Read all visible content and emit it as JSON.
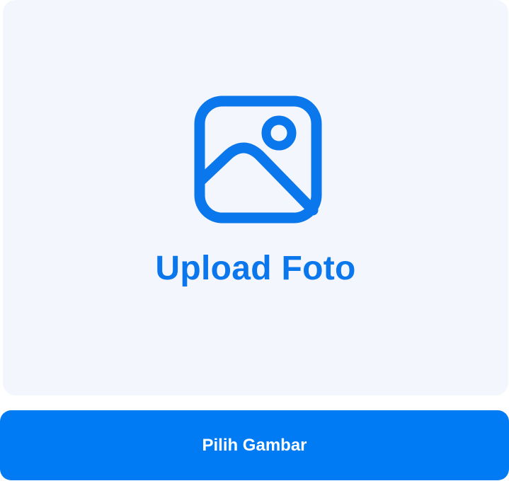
{
  "upload": {
    "icon": "image-icon",
    "title": "Upload Foto"
  },
  "button": {
    "label": "Pilih Gambar"
  },
  "colors": {
    "card_background": "#f3f6fd",
    "accent": "#0a77ec",
    "button_background": "#007bf3",
    "button_text": "#ffffff"
  }
}
